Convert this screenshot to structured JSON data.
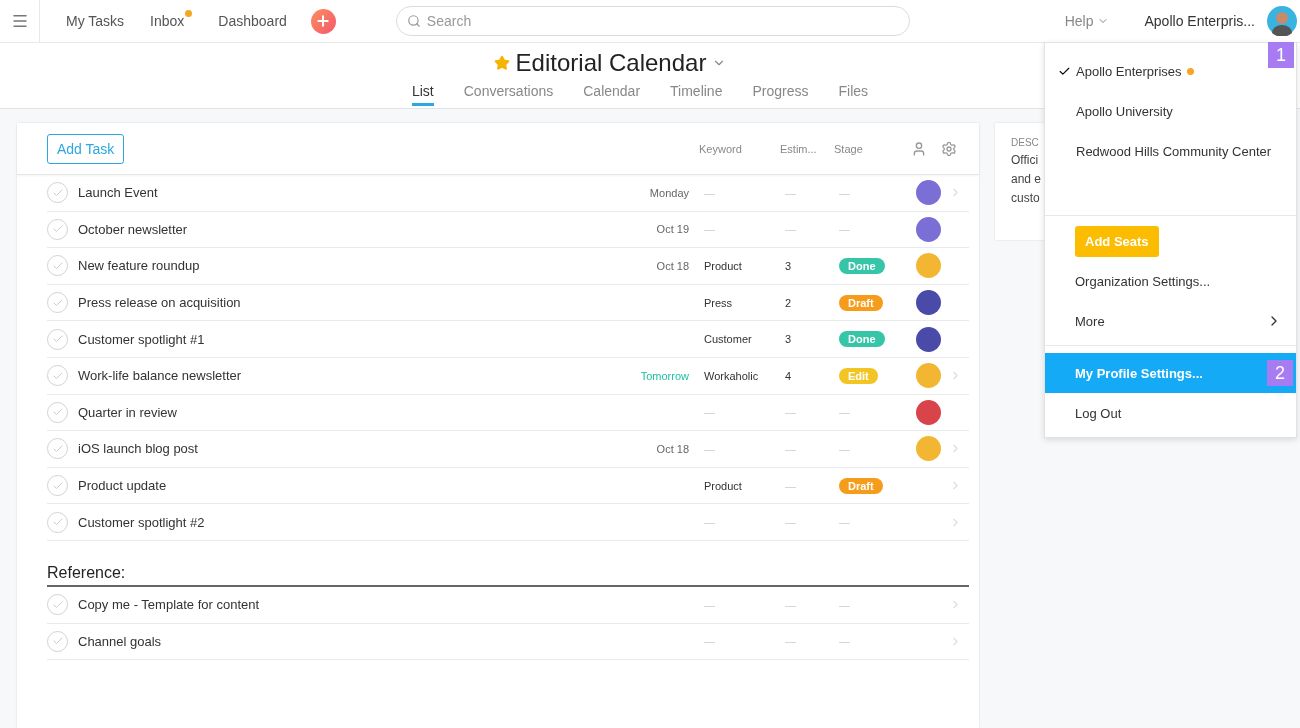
{
  "topbar": {
    "nav": [
      {
        "label": "My Tasks",
        "notify": false
      },
      {
        "label": "Inbox",
        "notify": true
      },
      {
        "label": "Dashboard",
        "notify": false
      }
    ],
    "search": {
      "placeholder": "Search"
    },
    "help": "Help",
    "org": "Apollo Enterpris..."
  },
  "project": {
    "title": "Editorial Calendar",
    "favorite": true,
    "tabs": [
      {
        "label": "List",
        "selected": true
      },
      {
        "label": "Conversations",
        "selected": false
      },
      {
        "label": "Calendar",
        "selected": false
      },
      {
        "label": "Timeline",
        "selected": false
      },
      {
        "label": "Progress",
        "selected": false
      },
      {
        "label": "Files",
        "selected": false
      }
    ]
  },
  "list": {
    "add_button": "Add Task",
    "columns": [
      "Keyword",
      "Estim...",
      "Stage"
    ],
    "rows": [
      {
        "name": "Launch Event",
        "completed": false,
        "due": "Monday",
        "due_soon": false,
        "keyword": "—",
        "estimate": "—",
        "stage": {
          "label": "—"
        },
        "avatar": {
          "color": "#7b6fd6"
        },
        "arrow": true
      },
      {
        "name": "October newsletter",
        "completed": false,
        "due": "Oct 19",
        "due_soon": false,
        "keyword": "—",
        "estimate": "—",
        "stage": {
          "label": "—"
        },
        "avatar": {
          "color": "#7b6fd6"
        },
        "arrow": false
      },
      {
        "name": "New feature roundup",
        "completed": false,
        "due": "Oct 18",
        "due_soon": false,
        "keyword": "Product",
        "estimate": "3",
        "stage": {
          "label": "Done",
          "color": "#37c5a8"
        },
        "avatar": {
          "color": "#f2b632"
        },
        "arrow": false
      },
      {
        "name": "Press release on acquisition",
        "completed": false,
        "keyword": "Press",
        "estimate": "2",
        "stage": {
          "label": "Draft",
          "color": "#f59c1a"
        },
        "avatar": {
          "color": "#4a4aa8"
        },
        "arrow": false
      },
      {
        "name": "Customer spotlight #1",
        "completed": false,
        "keyword": "Customer",
        "estimate": "3",
        "stage": {
          "label": "Done",
          "color": "#37c5a8"
        },
        "avatar": {
          "color": "#4a4aa8"
        },
        "arrow": false
      },
      {
        "name": "Work-life balance newsletter",
        "completed": false,
        "due": "Tomorrow",
        "due_soon": true,
        "keyword": "Workaholic",
        "estimate": "4",
        "stage": {
          "label": "Edit",
          "color": "#f2c524"
        },
        "avatar": {
          "color": "#f2b632"
        },
        "arrow": true
      },
      {
        "name": "Quarter in review",
        "completed": false,
        "keyword": "—",
        "estimate": "—",
        "stage": {
          "label": "—"
        },
        "avatar": {
          "color": "#d9434a"
        },
        "arrow": false
      },
      {
        "name": "iOS launch blog post",
        "completed": false,
        "due": "Oct 18",
        "due_soon": false,
        "keyword": "—",
        "estimate": "—",
        "stage": {
          "label": "—"
        },
        "avatar": {
          "color": "#f2b632"
        },
        "arrow": true
      },
      {
        "name": "Product update",
        "completed": false,
        "keyword": "Product",
        "estimate": "—",
        "stage": {
          "label": "Draft",
          "color": "#f59c1a"
        },
        "arrow": true
      },
      {
        "name": "Customer spotlight #2",
        "completed": false,
        "keyword": "—",
        "estimate": "—",
        "stage": {
          "label": "—"
        },
        "arrow": true
      }
    ],
    "section": "Reference:",
    "section_rows": [
      {
        "name": "Copy me - Template for content",
        "completed": false,
        "keyword": "—",
        "estimate": "—",
        "stage": {
          "label": "—"
        },
        "arrow": true
      },
      {
        "name": "Channel goals",
        "completed": false,
        "keyword": "—",
        "estimate": "—",
        "stage": {
          "label": "—"
        },
        "arrow": true
      }
    ]
  },
  "description": {
    "heading": "DESC",
    "lines": [
      "Offici",
      "and e",
      "custo"
    ]
  },
  "menu": {
    "orgs": [
      {
        "label": "Apollo Enterprises",
        "checked": true,
        "color": "#f5a623"
      },
      {
        "label": "Apollo University",
        "checked": false
      },
      {
        "label": "Redwood Hills Community Center",
        "checked": false
      }
    ],
    "add_seats": "Add Seats",
    "items": [
      {
        "label": "Organization Settings...",
        "kind": "plain",
        "selected": false
      },
      {
        "label": "More",
        "kind": "submenu",
        "selected": false
      }
    ],
    "account": [
      {
        "label": "My Profile Settings...",
        "selected": true
      },
      {
        "label": "Log Out",
        "selected": false
      }
    ]
  },
  "callouts": [
    "1",
    "2"
  ]
}
